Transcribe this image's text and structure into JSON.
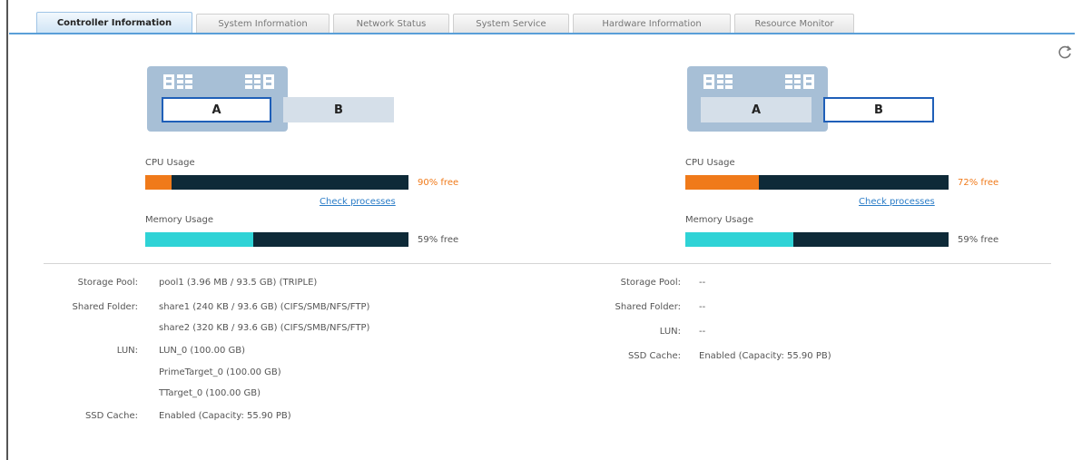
{
  "tabs": [
    {
      "label": "Controller Information",
      "active": true
    },
    {
      "label": "System Information",
      "active": false
    },
    {
      "label": "Network Status",
      "active": false
    },
    {
      "label": "System Service",
      "active": false
    },
    {
      "label": "Hardware Information",
      "active": false
    },
    {
      "label": "Resource Monitor",
      "active": false
    }
  ],
  "controllers": [
    {
      "slots": [
        "A",
        "B"
      ],
      "selected": "A",
      "cpu_label": "CPU Usage",
      "cpu_used": 0.1,
      "cpu_text": "90% free",
      "check_link": "Check processes",
      "mem_label": "Memory Usage",
      "mem_used": 0.41,
      "mem_text": "59% free",
      "details": {
        "storage_pool_label": "Storage Pool:",
        "storage_pool": "pool1 (3.96 MB / 93.5 GB) (TRIPLE)",
        "shared_folder_label": "Shared Folder:",
        "shared_folders": [
          "share1 (240 KB / 93.6 GB) (CIFS/SMB/NFS/FTP)",
          "share2 (320 KB / 93.6 GB) (CIFS/SMB/NFS/FTP)"
        ],
        "lun_label": "LUN:",
        "luns": [
          "LUN_0 (100.00 GB)",
          "PrimeTarget_0 (100.00 GB)",
          "TTarget_0 (100.00 GB)"
        ],
        "ssd_cache_label": "SSD Cache:",
        "ssd_cache": "Enabled (Capacity: 55.90 PB)"
      }
    },
    {
      "slots": [
        "A",
        "B"
      ],
      "selected": "B",
      "cpu_label": "CPU Usage",
      "cpu_used": 0.28,
      "cpu_text": "72% free",
      "check_link": "Check processes",
      "mem_label": "Memory Usage",
      "mem_used": 0.41,
      "mem_text": "59% free",
      "details": {
        "storage_pool_label": "Storage Pool:",
        "storage_pool": "--",
        "shared_folder_label": "Shared Folder:",
        "shared_folder": "--",
        "lun_label": "LUN:",
        "lun": "--",
        "ssd_cache_label": "SSD Cache:",
        "ssd_cache": "Enabled (Capacity: 55.90 PB)"
      }
    }
  ],
  "colors": {
    "cpu": "#f07a1a",
    "mem": "#2fd3d6",
    "bar_bg": "#0e2a38",
    "cpu_text": "#f07a1a",
    "mem_text": "#555555",
    "accent": "#5a9fd8"
  },
  "icons": {
    "refresh": "refresh-icon",
    "drive_left": "drive-left-icon",
    "drive_right": "drive-right-icon"
  }
}
